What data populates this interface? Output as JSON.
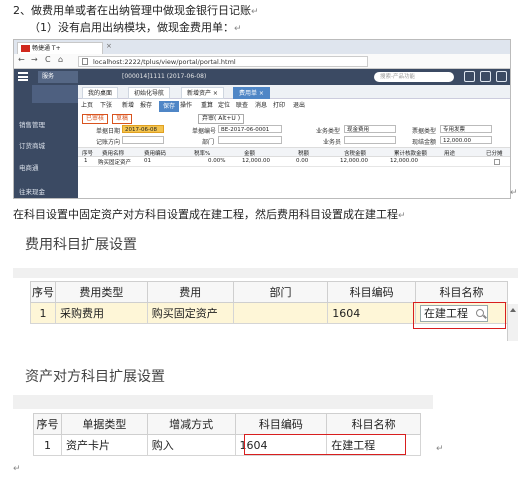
{
  "doc": {
    "heading": "2、做费用单或者在出纳管理中做现金银行日记账",
    "subheading": "（1）没有启用出纳模块，做现金费用单：",
    "middle_para": "在科目设置中固定资产对方科目设置成在建工程，然后费用科目设置成在建工程",
    "return_mark": "↵"
  },
  "browser": {
    "tab_title": "畅捷通 T+",
    "close_glyph": "×",
    "back_glyph": "←",
    "forward_glyph": "→",
    "reload_glyph": "C",
    "home_glyph": "⌂",
    "url": "localhost:2222/tplus/view/portal/portal.html",
    "services_label": "服务",
    "org_text": "[000014]1111  (2017-06-08)",
    "search_placeholder": "搜索-产品功能"
  },
  "sidebar": {
    "items": [
      {
        "label": "销售管理"
      },
      {
        "label": "订货商城"
      },
      {
        "label": "电商通"
      },
      {
        "label": "往来现金"
      }
    ]
  },
  "page_tabs": [
    "我的桌面",
    "初始化导航",
    "新增资产 ×",
    "费用单 ×"
  ],
  "toolbar": {
    "items": [
      "上页",
      "下张",
      "新增",
      "报存",
      "保存",
      "操作",
      "重算",
      "定位",
      "联查",
      "消息",
      "打印",
      "退出"
    ]
  },
  "form": {
    "status1": "已审核",
    "status2": "草稿",
    "edit_label": "弃审( Alt+U )",
    "date_label": "单据日期",
    "date_value": "2017-06-08",
    "code_label": "单据编号",
    "code_value": "BE-2017-06-0001",
    "biz_type_label": "业务类型",
    "biz_type_value": "现金费用",
    "invoice_label": "票据类型",
    "invoice_value": "专用发票",
    "record_label": "记账方向",
    "dept_label": "部门",
    "staff_label": "业务员",
    "amount_label": "现结金额",
    "amount_value": "12,000.00"
  },
  "grid": {
    "headers": [
      "序号",
      "费用名称",
      "费用编码",
      "税率%",
      "金额",
      "税额",
      "含税金额",
      "累计核款金额",
      "用途",
      "已分摊"
    ],
    "row": [
      "1",
      "购买固定资产",
      "01",
      "",
      "0.00%",
      "12,000.00",
      "0.00",
      "12,000.00",
      "12,000.00",
      ""
    ]
  },
  "expense_table": {
    "title": "费用科目扩展设置",
    "headers": [
      "序号",
      "费用类型",
      "费用",
      "部门",
      "科目编码",
      "科目名称"
    ],
    "row": {
      "index": "1",
      "type": "采购费用",
      "expense": "购买固定资产",
      "dept": "",
      "code": "1604",
      "name": "在建工程"
    }
  },
  "asset_table": {
    "title": "资产对方科目扩展设置",
    "headers": [
      "序号",
      "单据类型",
      "增减方式",
      "科目编码",
      "科目名称"
    ],
    "row": {
      "index": "1",
      "doc_type": "资产卡片",
      "method": "购入",
      "code": "1604",
      "name": "在建工程"
    }
  },
  "colors": {
    "highlight_red": "#d81e1e",
    "app_dark_blue": "#3b4a63",
    "row_yellow": "#fef6d7"
  }
}
